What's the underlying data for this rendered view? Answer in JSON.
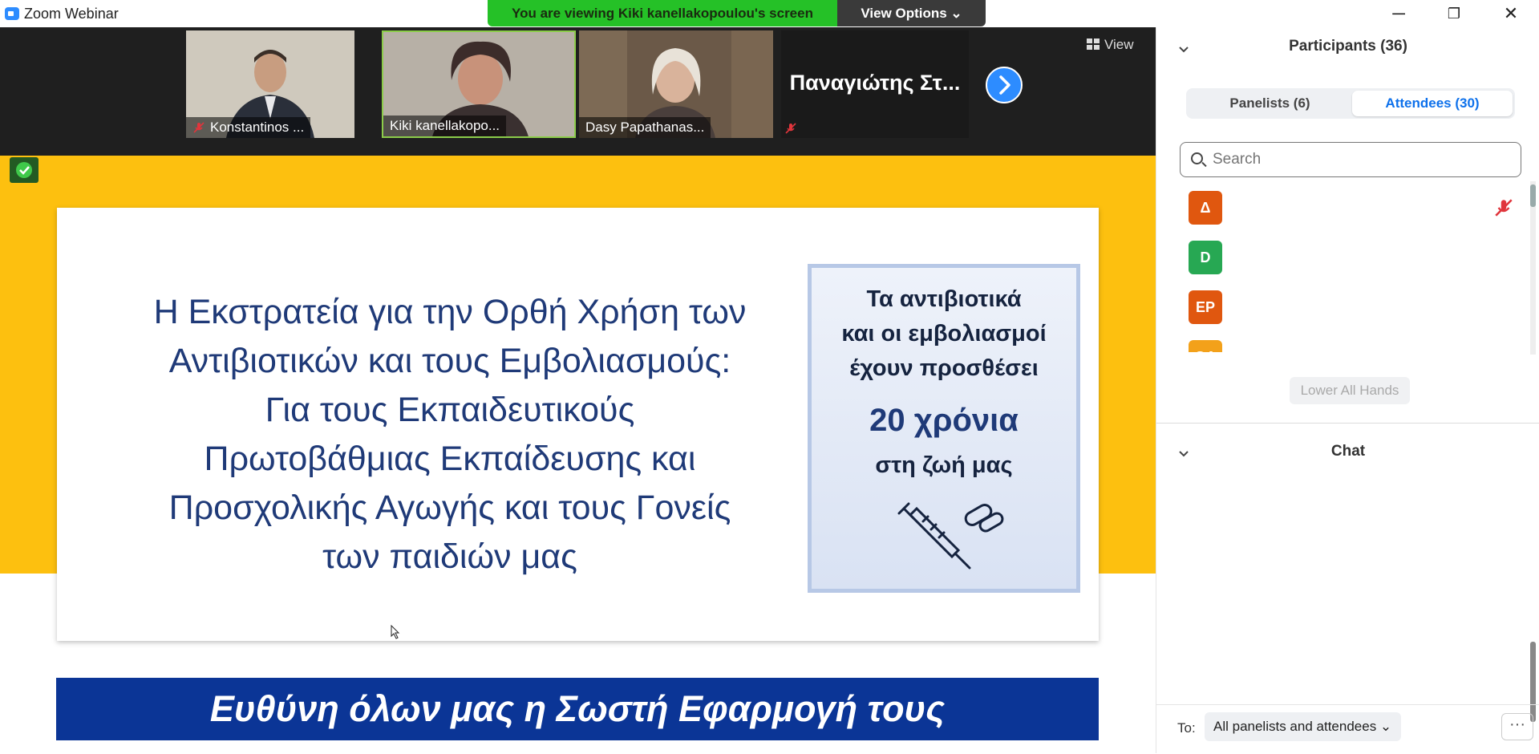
{
  "window": {
    "title": "Zoom Webinar",
    "minimize_glyph": "─",
    "restore_glyph": "❐",
    "close_glyph": "✕"
  },
  "banner": {
    "viewing_text": "You are viewing Kiki kanellakopoulou's screen",
    "view_options_label": "View Options ⌄"
  },
  "video_strip": {
    "tiles": [
      {
        "name": "Konstantinos ...",
        "muted": true
      },
      {
        "name": "Kiki kanellakopo...",
        "muted": false,
        "active_speaker": true
      },
      {
        "name": "Dasy Papathanas...",
        "muted": false
      }
    ],
    "name_only_tile": {
      "name": "Παναγιώτης Στ...",
      "muted": true
    },
    "view_label": "View"
  },
  "slide": {
    "title_lines": [
      "Η Εκστρατεία για την Ορθή Χρήση των",
      "Αντιβιοτικών και τους Εμβολιασμούς:",
      "Για τους Εκπαιδευτικούς",
      "Πρωτοβάθμιας Εκπαίδευσης και",
      "Προσχολικής Αγωγής και τους Γονείς",
      "των παιδιών μας"
    ],
    "poster_lines": [
      "Τα αντιβιοτικά",
      "και οι εμβολιασμοί",
      "έχουν προσθέσει"
    ],
    "poster_years": "20 χρόνια",
    "poster_life": "στη ζωή μας",
    "bottom_banner": "Ευθύνη όλων μας η Σωστή Εφαρμογή τους"
  },
  "participants": {
    "header": "Participants (36)",
    "tabs": [
      {
        "label": "Panelists (6)",
        "selected": false
      },
      {
        "label": "Attendees (30)",
        "selected": true
      }
    ],
    "search_placeholder": "Search",
    "items": [
      {
        "initials": "Δ",
        "color": "#e0570f",
        "muted": true
      },
      {
        "initials": "D",
        "color": "#27a853",
        "muted": false
      },
      {
        "initials": "EP",
        "color": "#e0570f",
        "muted": false
      },
      {
        "initials": "GA",
        "color": "#f3a11a",
        "muted": false
      }
    ],
    "lower_all_hands": "Lower All Hands"
  },
  "chat": {
    "header": "Chat",
    "to_label": "To:",
    "to_value": "All panelists and attendees ⌄",
    "more_glyph": "···"
  },
  "colors": {
    "zoom_blue": "#2d8cff",
    "banner_green": "#25c127",
    "slide_yellow": "#fdc00f",
    "slide_navy": "#1f3a78",
    "bar_blue": "#0b3596"
  }
}
